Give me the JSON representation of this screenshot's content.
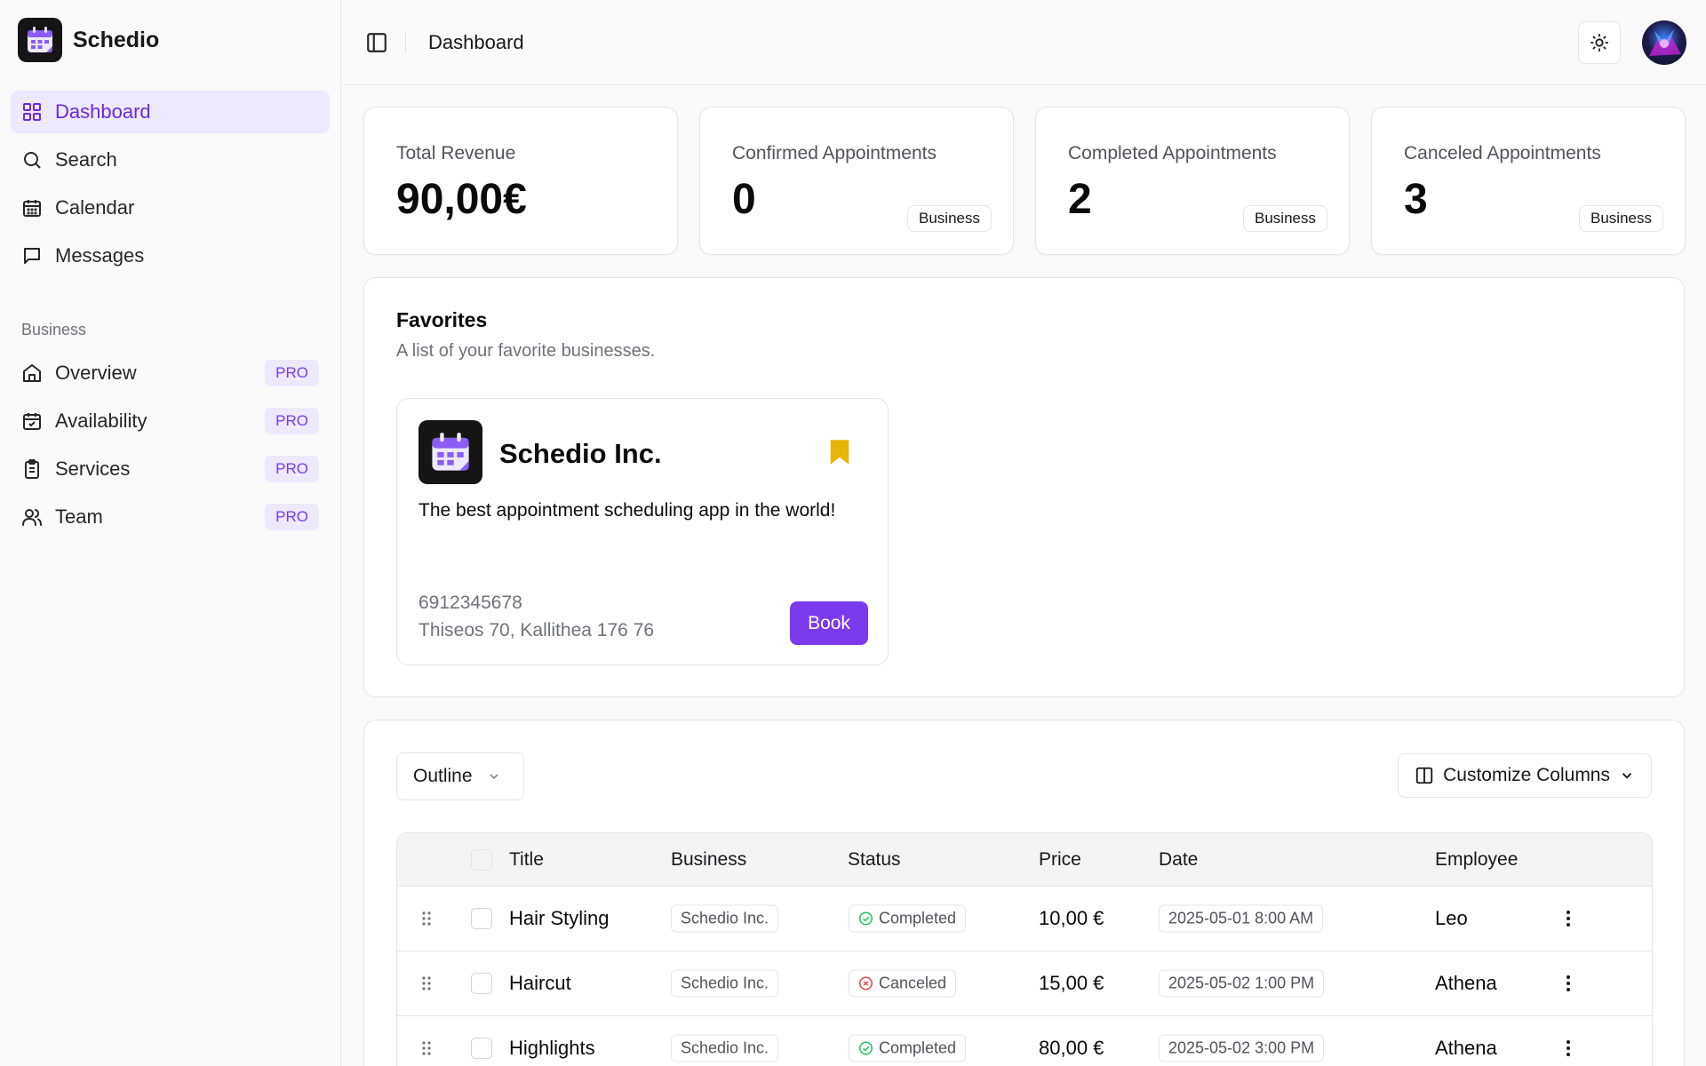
{
  "app": {
    "name": "Schedio"
  },
  "header": {
    "title": "Dashboard"
  },
  "sidebar": {
    "main_items": [
      {
        "label": "Dashboard",
        "icon": "grid-icon",
        "active": true
      },
      {
        "label": "Search",
        "icon": "search-icon"
      },
      {
        "label": "Calendar",
        "icon": "calendar-icon"
      },
      {
        "label": "Messages",
        "icon": "message-icon"
      }
    ],
    "section_label": "Business",
    "business_items": [
      {
        "label": "Overview",
        "icon": "home-icon",
        "badge": "PRO"
      },
      {
        "label": "Availability",
        "icon": "calendar-check-icon",
        "badge": "PRO"
      },
      {
        "label": "Services",
        "icon": "clipboard-icon",
        "badge": "PRO"
      },
      {
        "label": "Team",
        "icon": "users-icon",
        "badge": "PRO"
      }
    ]
  },
  "stats": [
    {
      "label": "Total Revenue",
      "value": "90,00€",
      "badge": ""
    },
    {
      "label": "Confirmed Appointments",
      "value": "0",
      "badge": "Business"
    },
    {
      "label": "Completed Appointments",
      "value": "2",
      "badge": "Business"
    },
    {
      "label": "Canceled Appointments",
      "value": "3",
      "badge": "Business"
    }
  ],
  "favorites": {
    "title": "Favorites",
    "subtitle": "A list of your favorite businesses.",
    "business": {
      "name": "Schedio Inc.",
      "description": "The best appointment scheduling app in the world!",
      "phone": "6912345678",
      "address": "Thiseos 70, Kallithea 176 76",
      "book_label": "Book"
    }
  },
  "table": {
    "view_select": "Outline",
    "customize_label": "Customize Columns",
    "columns": [
      "Title",
      "Business",
      "Status",
      "Price",
      "Date",
      "Employee"
    ],
    "rows": [
      {
        "title": "Hair Styling",
        "business": "Schedio Inc.",
        "status": "Completed",
        "price": "10,00 €",
        "date": "2025-05-01 8:00 AM",
        "employee": "Leo"
      },
      {
        "title": "Haircut",
        "business": "Schedio Inc.",
        "status": "Canceled",
        "price": "15,00 €",
        "date": "2025-05-02 1:00 PM",
        "employee": "Athena"
      },
      {
        "title": "Highlights",
        "business": "Schedio Inc.",
        "status": "Completed",
        "price": "80,00 €",
        "date": "2025-05-02 3:00 PM",
        "employee": "Athena"
      }
    ]
  },
  "colors": {
    "accent": "#7c3aed",
    "active_bg": "#ede9fe",
    "completed": "#22c55e",
    "canceled": "#ef4444",
    "bookmark": "#eab308"
  }
}
